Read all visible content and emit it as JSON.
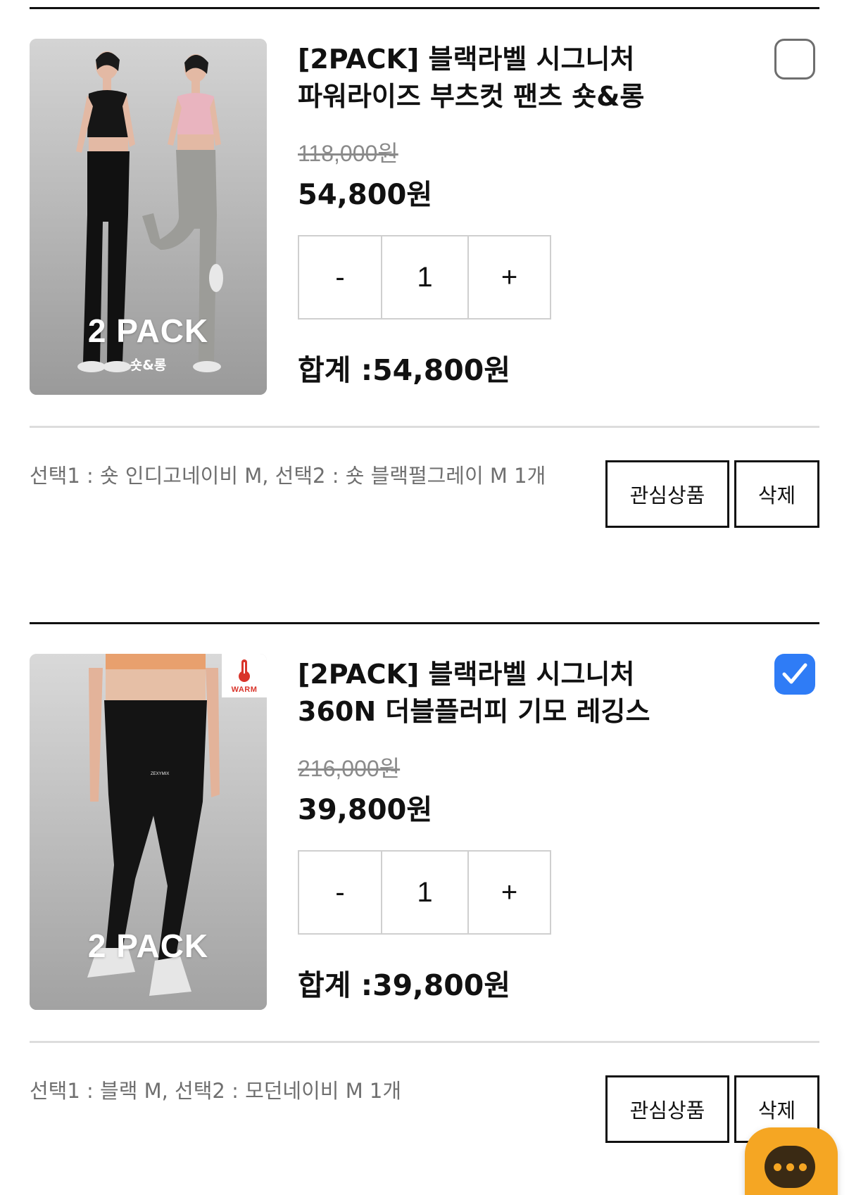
{
  "items": [
    {
      "title_line1": "[2PACK] 블랙라벨 시그니처",
      "title_line2": "파워라이즈 부츠컷 팬츠 숏&롱",
      "original_price": "118,000원",
      "sale_price": "54,800원",
      "quantity": "1",
      "minus_label": "-",
      "plus_label": "+",
      "total_label": "합계 :54,800원",
      "options": "선택1 : 숏 인디고네이비 M, 선택2 : 숏 블랙펄그레이 M 1개",
      "wishlist_label": "관심상품",
      "delete_label": "삭제",
      "checked": false,
      "image": {
        "pack_label": "2 PACK",
        "pack_sub": "숏&롱"
      }
    },
    {
      "title_line1": "[2PACK] 블랙라벨 시그니처",
      "title_line2": "360N 더블플러피 기모 레깅스",
      "original_price": "216,000원",
      "sale_price": "39,800원",
      "quantity": "1",
      "minus_label": "-",
      "plus_label": "+",
      "total_label": "합계 :39,800원",
      "options": "선택1 : 블랙 M, 선택2 : 모던네이비 M 1개",
      "wishlist_label": "관심상품",
      "delete_label": "삭제",
      "checked": true,
      "image": {
        "pack_label": "2 PACK",
        "badge_text": "WARM"
      }
    }
  ],
  "colors": {
    "checkbox_checked": "#2f7cf6",
    "chat_button": "#f5a623",
    "original_price": "#8a8a8a"
  },
  "icons": {
    "checkbox_checked": "check-icon",
    "chat": "chat-bubble-icon",
    "warm_badge": "thermometer-icon"
  }
}
